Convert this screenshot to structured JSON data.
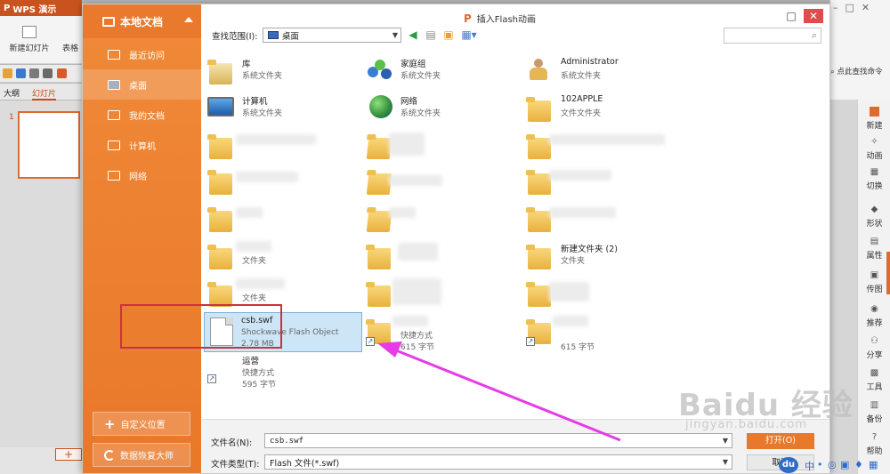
{
  "wps": {
    "app_title": "WPS 演示",
    "new_slide_label": "新建幻灯片",
    "table_label": "表格",
    "tab_outline": "大纲",
    "tab_slides": "幻灯片",
    "slide_number": "1",
    "find_command": "点此查找命令",
    "sidebar": [
      "新建",
      "动画",
      "切换",
      "形状",
      "属性",
      "传图",
      "推荐",
      "分享",
      "工具",
      "备份",
      "帮助"
    ]
  },
  "dialog": {
    "title": "插入Flash动画",
    "nav_header": "本地文档",
    "nav_items": [
      "最近访问",
      "桌面",
      "我的文档",
      "计算机",
      "网络"
    ],
    "nav_buttons": [
      "自定义位置",
      "数据恢复大师"
    ],
    "lookin_label": "查找范围(I):",
    "lookin_value": "桌面",
    "search_placeholder": "",
    "filename_label": "文件名(N):",
    "filename_value": "csb.swf",
    "filetype_label": "文件类型(T):",
    "filetype_value": "Flash 文件(*.swf)",
    "open_label": "打开(O)",
    "cancel_label": "取消"
  },
  "files": [
    {
      "name": "库",
      "type": "系统文件夹"
    },
    {
      "name": "家庭组",
      "type": "系统文件夹"
    },
    {
      "name": "Administrator",
      "type": "系统文件夹"
    },
    {
      "name": "计算机",
      "type": "系统文件夹"
    },
    {
      "name": "网络",
      "type": "系统文件夹"
    },
    {
      "name": "102APPLE",
      "type": "文件文件夹"
    },
    {
      "name": "新建文件夹 (2)",
      "type": "文件夹"
    },
    {
      "name": "csb.swf",
      "type": "Shockwave Flash Object",
      "size": "2.78 MB"
    },
    {
      "name": "运营",
      "type": "快捷方式",
      "size": "595 字节"
    }
  ],
  "blurred_labels": {
    "folder_type": "文件夹",
    "shortcut_type": "快捷方式",
    "shortcut_size": "615 字节"
  },
  "watermark": {
    "brand": "Baidu 经验",
    "url": "jingyan.baidu.com"
  },
  "colors": {
    "nav_orange": "#ec8030",
    "accent": "#e7792c",
    "highlight_red": "#c83340",
    "arrow_magenta": "#e83be8",
    "selection_blue": "#cde6f7"
  }
}
